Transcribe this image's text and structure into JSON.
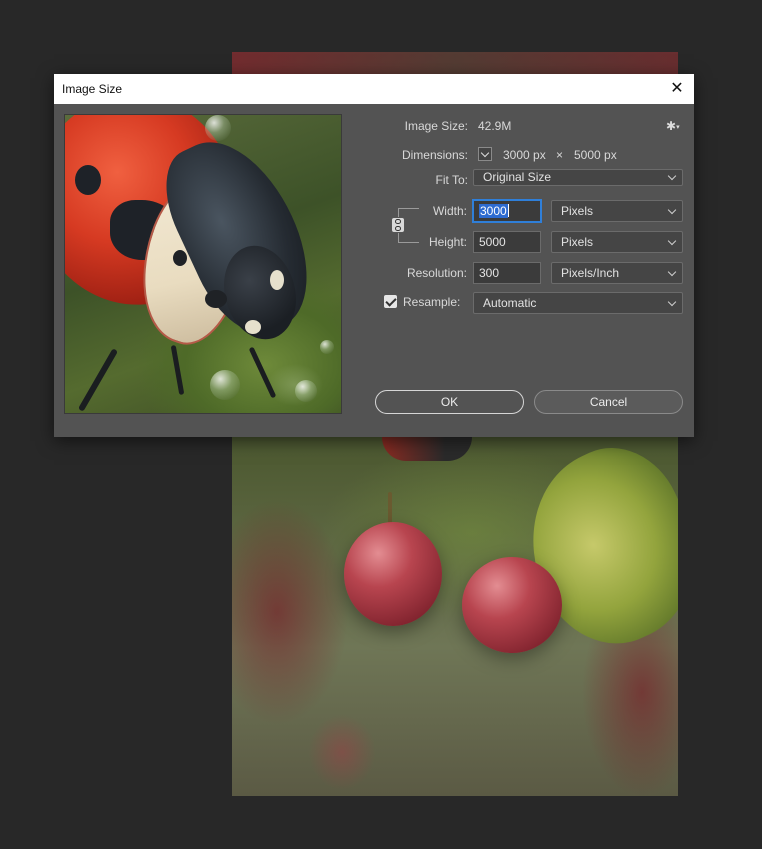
{
  "dialog": {
    "title": "Image Size",
    "close_symbol": "✕"
  },
  "info": {
    "image_size_label": "Image Size:",
    "image_size_value": "42.9M",
    "dimensions_label": "Dimensions:",
    "dimensions_width": "3000 px",
    "dimensions_times": "×",
    "dimensions_height": "5000 px"
  },
  "fit_to": {
    "label": "Fit To:",
    "value": "Original Size"
  },
  "width": {
    "label": "Width:",
    "value": "3000",
    "unit": "Pixels"
  },
  "height": {
    "label": "Height:",
    "value": "5000",
    "unit": "Pixels"
  },
  "resolution": {
    "label": "Resolution:",
    "value": "300",
    "unit": "Pixels/Inch"
  },
  "resample": {
    "label": "Resample:",
    "checked": true,
    "value": "Automatic"
  },
  "buttons": {
    "ok": "OK",
    "cancel": "Cancel"
  },
  "icons": {
    "settings": "gear-icon",
    "constrain": "link-icon",
    "close": "close-icon"
  },
  "colors": {
    "dialog_bg": "#535353",
    "app_bg": "#282828",
    "focus": "#2f7fd9"
  }
}
